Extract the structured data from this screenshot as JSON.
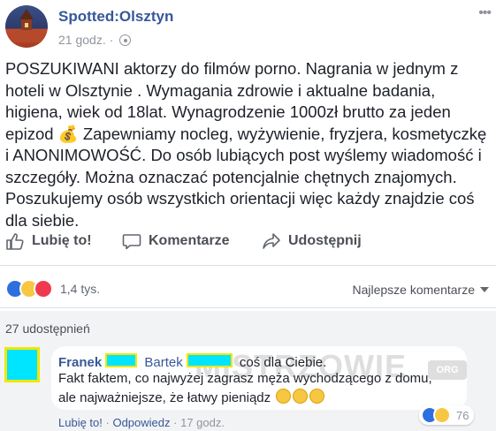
{
  "header": {
    "page_name": "Spotted:Olsztyn",
    "time": "21 godz.",
    "dot": "·"
  },
  "post": {
    "text": "POSZUKIWANI aktorzy do filmów porno. Nagrania w jednym z hoteli w Olsztynie . Wymagania zdrowie i aktualne badania, higiena, wiek od 18lat. Wynagrodzenie 1000zł brutto za jeden epizod 💰 Zapewniamy nocleg, wyżywienie, fryzjera, kosmetyczkę i ANONIMOWOŚĆ. Do osób lubiących post wyślemy wiadomość i szczegóły. Można oznaczać potencjalnie chętnych znajomych. Poszukujemy osób wszystkich orientacji więc każdy znajdzie coś dla siebie."
  },
  "actions": {
    "like": "Lubię to!",
    "comment": "Komentarze",
    "share": "Udostępnij"
  },
  "reactions": {
    "count": "1,4 tys.",
    "sort_label": "Najlepsze komentarze"
  },
  "shares": "27 udostępnień",
  "comment": {
    "author": "Franek",
    "tag_name": "Bartek",
    "line1_end": "coś dla Ciebie.",
    "line2": "Fakt faktem, co najwyżej zagrasz męża wychodzącego z domu,",
    "line3": "ale najważniejsze, że łatwy pieniądz",
    "reaction_count": "76",
    "like": "Lubię to!",
    "reply": "Odpowiedz",
    "time": "17 godz.",
    "sep": "·"
  },
  "watermark": {
    "text": "MISTRZOWIE",
    "badge": "ORG"
  },
  "colors": {
    "link": "#365899",
    "redaction_fill": "#00e5ff",
    "redaction_border": "#f2e600"
  }
}
